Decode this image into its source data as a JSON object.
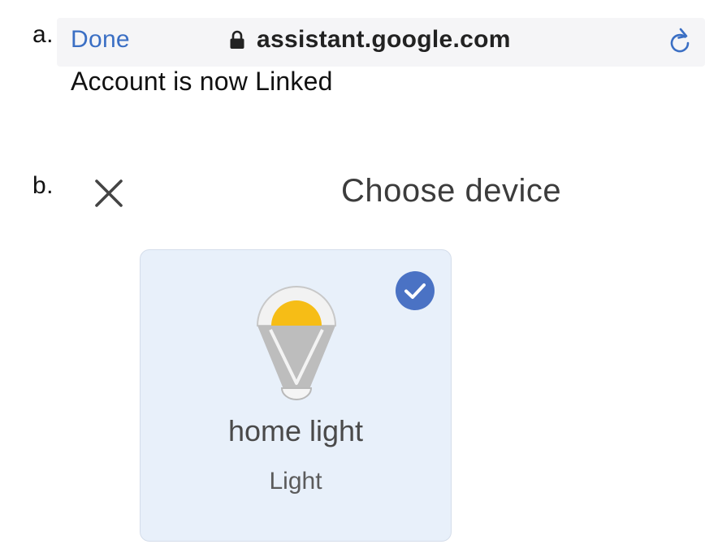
{
  "steps": {
    "a": "a.",
    "b": "b."
  },
  "browser": {
    "done_label": "Done",
    "url": "assistant.google.com",
    "lock_icon": "lock-icon",
    "reload_icon": "reload-icon"
  },
  "message": "Account is now Linked",
  "dialog": {
    "title": "Choose device",
    "close_icon": "close-icon"
  },
  "device": {
    "name": "home light",
    "type": "Light",
    "selected": true,
    "icon": "light-bulb-icon"
  },
  "colors": {
    "link_blue": "#3b6fc4",
    "card_background": "#e8f0fa",
    "check_badge": "#4a72c4",
    "bulb_yellow": "#f6bd16",
    "bulb_gray": "#bdbdbd"
  }
}
